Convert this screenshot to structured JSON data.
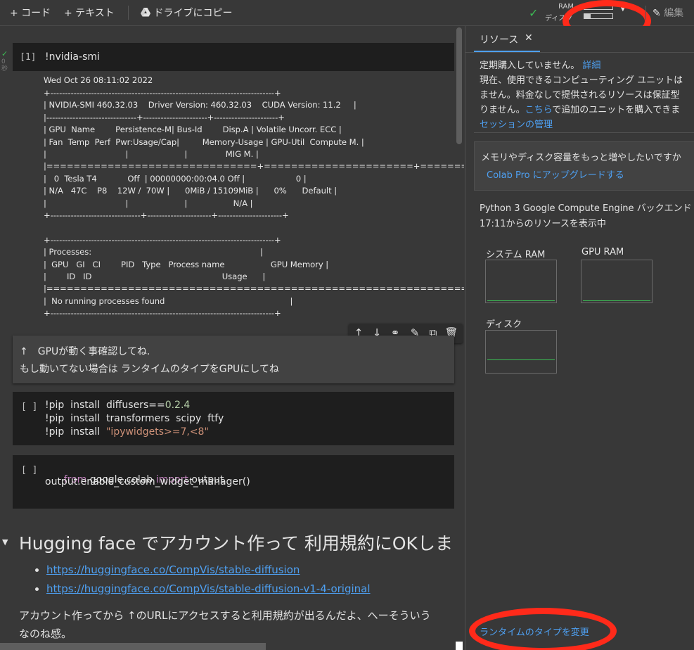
{
  "toolbar": {
    "add_code": "+ コード",
    "add_text": "+ テキスト",
    "copy_drive": "ドライブにコピー",
    "ram_label": "RAM",
    "disk_label": "ディスク",
    "edit_label": "編集"
  },
  "cell1": {
    "count": "[1]",
    "source": "!nvidia-smi",
    "exec_time": "0\n秒",
    "output": [
      "Wed Oct 26 08:11:02 2022",
      "+-----------------------------------------------------------------------------+",
      "| NVIDIA-SMI 460.32.03    Driver Version: 460.32.03    CUDA Version: 11.2     |",
      "|-------------------------------+----------------------+----------------------+",
      "| GPU  Name        Persistence-M| Bus-Id        Disp.A | Volatile Uncorr. ECC |",
      "| Fan  Temp  Perf  Pwr:Usage/Cap|         Memory-Usage | GPU-Util  Compute M. |",
      "|                               |                      |               MIG M. |",
      "|===============================+======================+======================|",
      "|   0  Tesla T4            Off  | 00000000:00:04.0 Off |                    0 |",
      "| N/A   47C    P8    12W /  70W |      0MiB / 15109MiB |      0%      Default |",
      "|                               |                      |                  N/A |",
      "+-------------------------------+----------------------+----------------------+",
      "",
      "+-----------------------------------------------------------------------------+",
      "| Processes:                                                                  |",
      "|  GPU   GI   CI        PID   Type   Process name                  GPU Memory |",
      "|        ID   ID                                                   Usage      |",
      "|=============================================================================|",
      "|  No running processes found                                                 |",
      "+-----------------------------------------------------------------------------+"
    ]
  },
  "text_cell": {
    "line1": "↑　GPUが動く事確認してね.",
    "line2": "もし動いてない場合は ランタイムのタイプをGPUにしてね"
  },
  "cell2": {
    "count": "[ ]",
    "lines": [
      {
        "pre": "!pip  install  diffusers==",
        "tok": "0.2.4",
        "cls": "num"
      },
      {
        "pre": "!pip  install  transformers  scipy  ftfy",
        "tok": "",
        "cls": ""
      },
      {
        "pre": "!pip  install  ",
        "tok": "\"ipywidgets>=7,<8\"",
        "cls": "str"
      }
    ]
  },
  "cell3": {
    "count": "[ ]",
    "line1_kw1": "from",
    "line1_mid": " google.colab ",
    "line1_kw2": "import",
    "line1_end": " output",
    "line2": "output.enable_custom_widget_manager()"
  },
  "section": {
    "heading": "Hugging face でアカウント作って 利用規約にOKしま",
    "links": [
      "https://huggingface.co/CompVis/stable-diffusion",
      "https://huggingface.co/CompVis/stable-diffusion-v1-4-original"
    ],
    "para1": "アカウント作ってから ↑のURLにアクセスすると利用規約が出るんだよ、へーそういう",
    "para2": "なのね感。"
  },
  "panel": {
    "tab": "リソース",
    "sub1_a": "定期購入していません。",
    "sub1_link": "詳細",
    "sub2": "現在、使用できるコンピューティング ユニットは",
    "sub3": "ません。料金なしで提供されるリソースは保証型",
    "sub4_a": "りません。",
    "sub4_link": "こちら",
    "sub4_b": "で追加のユニットを購入できま",
    "session_link": "セッションの管理",
    "upgrade_q": "メモリやディスク容量をもっと増やしたいですか",
    "upgrade_link": "Colab Pro にアップグレードする",
    "backend1": "Python 3 Google Compute Engine バックエンド (",
    "backend2": "17:11からのリソースを表示中",
    "sys_ram": "システム RAM",
    "gpu_ram": "GPU RAM",
    "disk": "ディスク",
    "runtime_link": "ランタイムのタイプを変更"
  },
  "colors": {
    "accent": "#4ea0f2",
    "annotation": "#ff2a1a",
    "ok": "#3cba54"
  }
}
